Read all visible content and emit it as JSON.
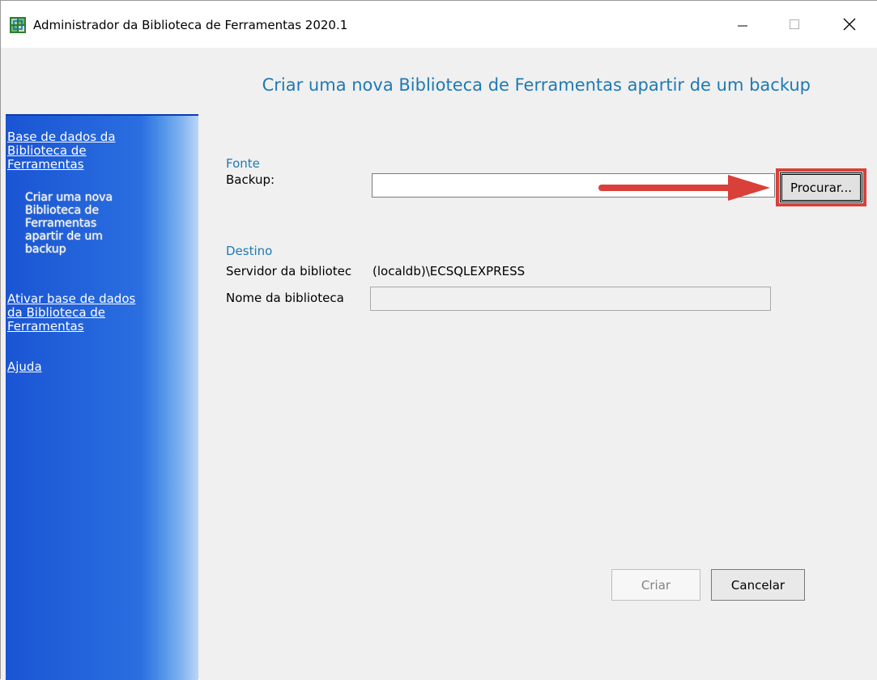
{
  "window": {
    "title": "Administrador da Biblioteca de Ferramentas 2020.1",
    "controls": {
      "minimize": "—",
      "maximize": "☐",
      "close": "✕"
    }
  },
  "header": {
    "title": "Criar uma nova Biblioteca de Ferramentas apartir de um backup"
  },
  "sidebar": {
    "link1": [
      "Base de dados da",
      "Biblioteca de",
      "Ferramentas"
    ],
    "sub": [
      "Criar uma nova",
      "Biblioteca de",
      "Ferramentas",
      "apartir de um",
      "backup"
    ],
    "link2": [
      "Ativar base de dados",
      "da Biblioteca de",
      "Ferramentas"
    ],
    "link3": "Ajuda"
  },
  "form": {
    "source_heading": "Fonte",
    "backup_label": "Backup:",
    "backup_value": "",
    "browse_label": "Procurar...",
    "dest_heading": "Destino",
    "server_label": "Servidor da bibliotec",
    "server_value": "(localdb)\\ECSQLEXPRESS",
    "name_label": "Nome da biblioteca",
    "name_value": ""
  },
  "buttons": {
    "create": "Criar",
    "cancel": "Cancelar"
  },
  "colors": {
    "accent_text": "#1d7ab4",
    "sidebar_blue": "#1a55d4",
    "annotation_red": "#d9403a"
  },
  "icons": {
    "app": "app-icon",
    "annotation": "arrow-right-icon"
  }
}
